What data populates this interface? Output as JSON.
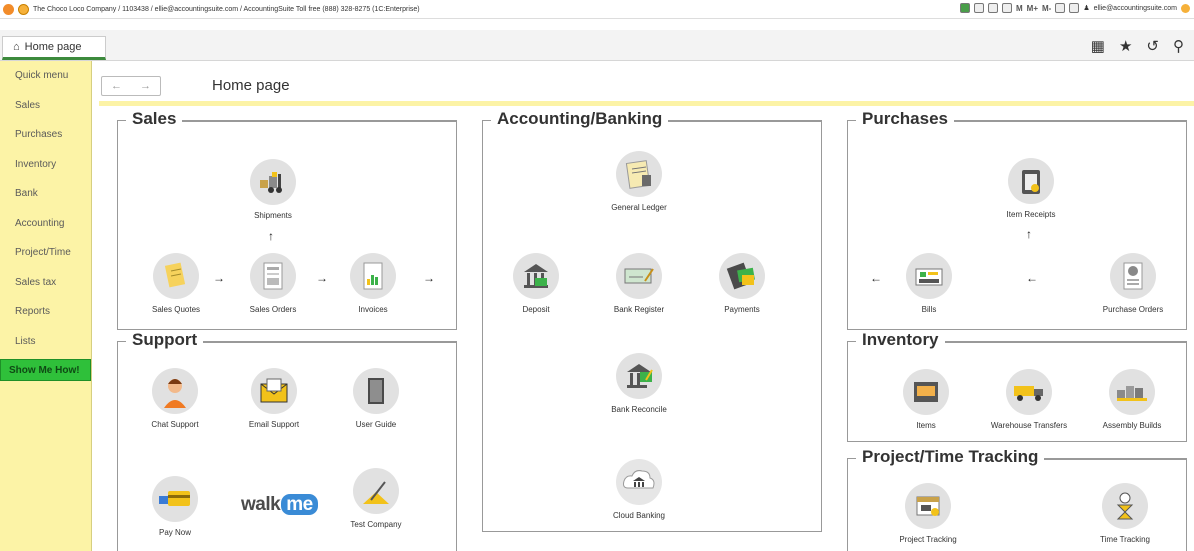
{
  "titlebar": {
    "text": "The Choco Loco Company / 1103438 / ellie@accountingsuite.com / AccountingSuite Toll free (888) 328-8275  (1C:Enterprise)",
    "m": "M",
    "mplus": "M+",
    "mminus": "M-",
    "user": "ellie@accountingsuite.com"
  },
  "tab": {
    "label": "Home page"
  },
  "sidebar": {
    "items": [
      {
        "label": "Quick menu"
      },
      {
        "label": "Sales"
      },
      {
        "label": "Purchases"
      },
      {
        "label": "Inventory"
      },
      {
        "label": "Bank"
      },
      {
        "label": "Accounting"
      },
      {
        "label": "Project/Time"
      },
      {
        "label": "Sales tax"
      },
      {
        "label": "Reports"
      },
      {
        "label": "Lists"
      }
    ],
    "show_me": "Show Me How!"
  },
  "nav": {
    "back": "←",
    "forward": "→"
  },
  "page_title": "Home page",
  "sales": {
    "title": "Sales",
    "shipments": "Shipments",
    "quotes": "Sales Quotes",
    "orders": "Sales Orders",
    "invoices": "Invoices"
  },
  "accounting": {
    "title": "Accounting/Banking",
    "general_ledger": "General Ledger",
    "deposit": "Deposit",
    "bank_register": "Bank Register",
    "payments": "Payments",
    "bank_reconcile": "Bank Reconcile",
    "cloud_banking": "Cloud Banking"
  },
  "purchases": {
    "title": "Purchases",
    "item_receipts": "Item Receipts",
    "bills": "Bills",
    "purchase_orders": "Purchase Orders"
  },
  "support": {
    "title": "Support",
    "chat": "Chat Support",
    "email": "Email Support",
    "guide": "User Guide",
    "pay": "Pay Now",
    "walkme_a": "walk",
    "walkme_b": "me",
    "test_company": "Test Company"
  },
  "inventory": {
    "title": "Inventory",
    "items": "Items",
    "warehouse": "Warehouse Transfers",
    "assembly": "Assembly Builds"
  },
  "project": {
    "title": "Project/Time Tracking",
    "project_tracking": "Project Tracking",
    "time_tracking": "Time Tracking"
  },
  "colors": {
    "sidebar_bg": "#fcf3a6",
    "show_me_bg": "#2fc03a",
    "accent": "#3c8a3c"
  }
}
